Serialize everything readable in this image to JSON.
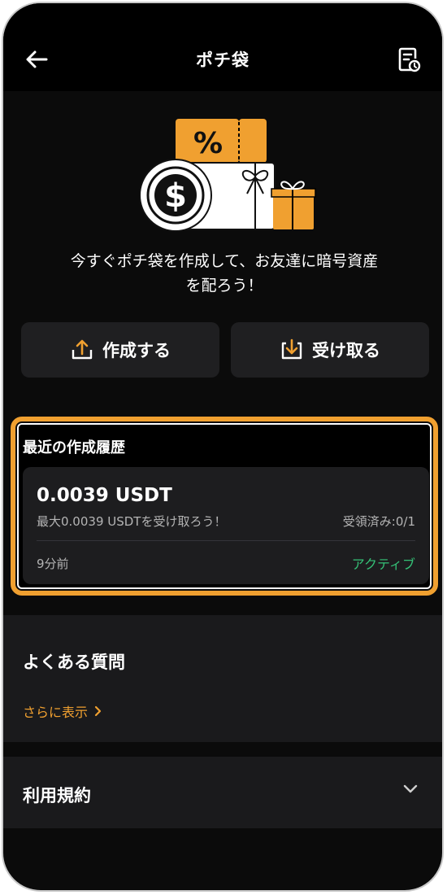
{
  "header": {
    "title": "ポチ袋",
    "back_icon": "arrow-left-icon",
    "history_icon": "receipt-clock-icon"
  },
  "hero": {
    "illustration_icon": "red-packet-gift-icon",
    "percent_glyph": "%",
    "dollar_glyph": "$",
    "lead_line1": "今すぐポチ袋を作成して、お友達に暗号資産",
    "lead_line2": "を配ろう！"
  },
  "actions": {
    "create_label": "作成する",
    "receive_label": "受け取る"
  },
  "history": {
    "section_label": "最近の作成履歴",
    "amount": "0.0039 USDT",
    "description": "最大0.0039 USDTを受け取ろう！",
    "claimed": "受領済み:0/1",
    "time": "9分前",
    "status": "アクティブ"
  },
  "faq": {
    "title": "よくある質問",
    "more_label": "さらに表示"
  },
  "terms": {
    "title": "利用規約"
  },
  "colors": {
    "accent": "#f0a030",
    "status_active": "#35c177",
    "background": "#0b0b0b",
    "card": "#1d1d1f"
  }
}
